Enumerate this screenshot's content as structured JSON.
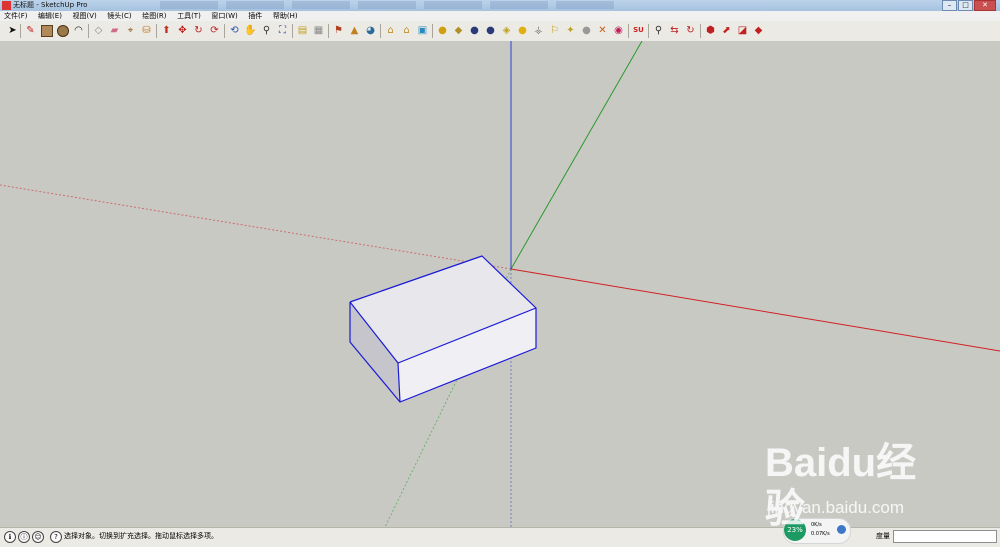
{
  "window": {
    "title": "无标题 - SketchUp Pro",
    "minimize": "–",
    "maximize": "□",
    "close": "✕"
  },
  "menu": {
    "items": [
      "文件(F)",
      "编辑(E)",
      "视图(V)",
      "镜头(C)",
      "绘图(R)",
      "工具(T)",
      "窗口(W)",
      "插件",
      "帮助(H)"
    ]
  },
  "toolbar": {
    "icons": [
      "select-arrow",
      "pencil",
      "rectangle",
      "circle",
      "arc",
      "eraser",
      "paint-bucket",
      "push-pull",
      "move",
      "rotate",
      "follow-me",
      "offset",
      "orbit",
      "pan",
      "zoom",
      "zoom-extents",
      "tape-measure",
      "protractor",
      "axes",
      "text",
      "3d-text",
      "section-plane",
      "camera",
      "walk",
      "look-around",
      "components",
      "materials",
      "styles",
      "layers",
      "scenes",
      "shadows",
      "fog",
      "sandbox",
      "photo-match",
      "geo-location",
      "google-earth",
      "3d-warehouse",
      "extension-warehouse",
      "layout",
      "send-to-layout",
      "su-ruby",
      "search",
      "undo",
      "redo",
      "print",
      "model-info"
    ]
  },
  "viewport": {
    "colors": {
      "background": "#c9c9c4",
      "axis_red": "#d02020",
      "axis_green": "#2a9a2a",
      "axis_blue": "#2a3fd2",
      "box_edge": "#1a1ad6",
      "face_top": "#e8e7ec",
      "face_front": "#f0eff4",
      "face_side": "#c6c5cc"
    }
  },
  "statusbar": {
    "text": "选择对象。切换到扩充选择。拖动鼠标选择多项。",
    "measure_label": "度量",
    "measure_value": ""
  },
  "network_widget": {
    "cpu_percent": "23%",
    "upload": "0K/s",
    "download": "0.07K/s"
  },
  "watermark": {
    "logo": "Baidu经验",
    "url": "jingyan.baidu.com"
  }
}
